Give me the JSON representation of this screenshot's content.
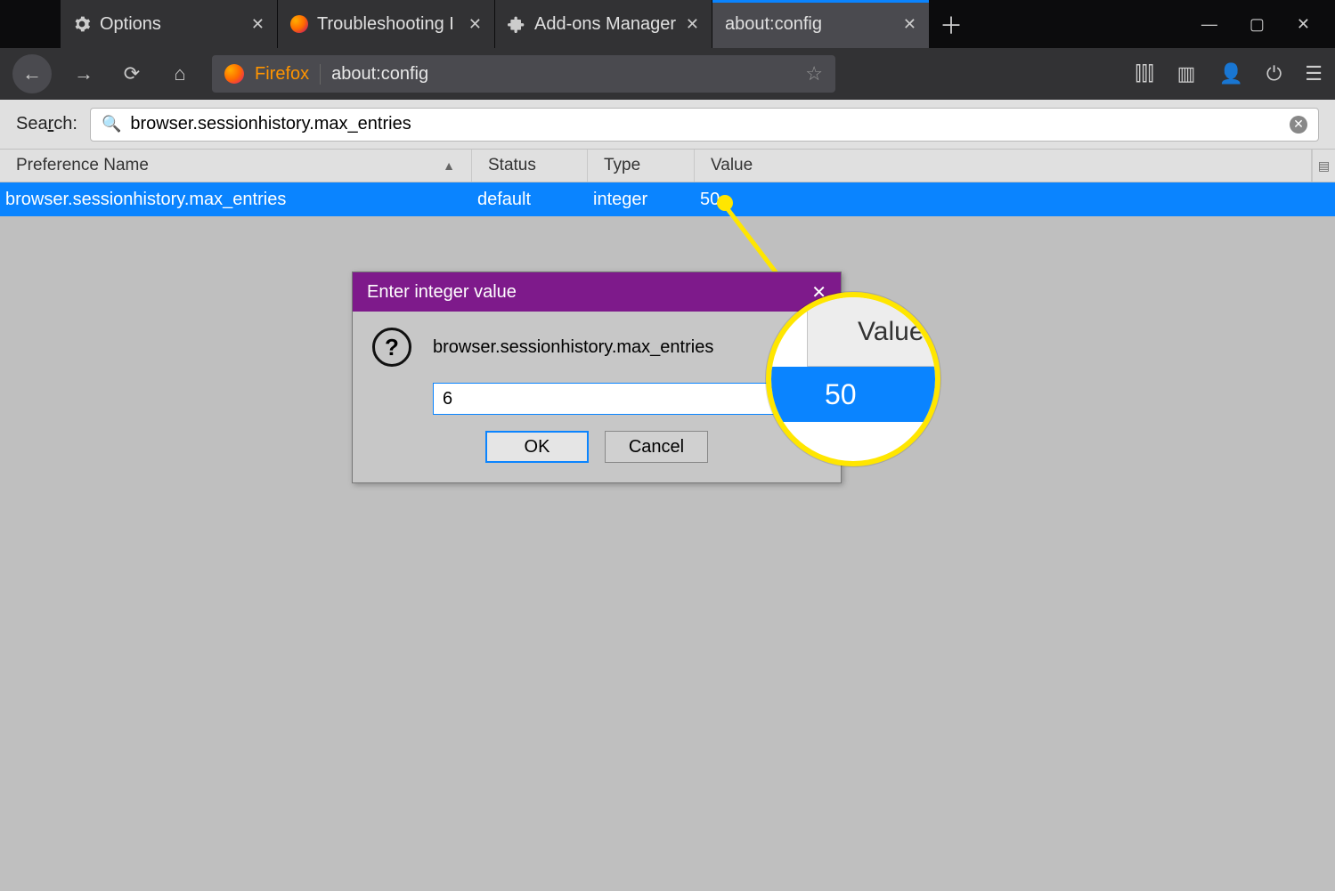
{
  "tabs": [
    {
      "label": "Options",
      "icon": "gear"
    },
    {
      "label": "Troubleshooting I",
      "icon": "firefox"
    },
    {
      "label": "Add-ons Manager",
      "icon": "puzzle"
    },
    {
      "label": "about:config",
      "icon": "",
      "active": true
    }
  ],
  "addressbar": {
    "brand": "Firefox",
    "url": "about:config"
  },
  "search": {
    "label": "Search:",
    "value": "browser.sessionhistory.max_entries"
  },
  "columns": {
    "name": "Preference Name",
    "status": "Status",
    "type": "Type",
    "value": "Value"
  },
  "row": {
    "name": "browser.sessionhistory.max_entries",
    "status": "default",
    "type": "integer",
    "value": "50"
  },
  "dialog": {
    "title": "Enter integer value",
    "pref": "browser.sessionhistory.max_entries",
    "input": "6",
    "ok": "OK",
    "cancel": "Cancel",
    "close": "✕"
  },
  "callout": {
    "header": "Value",
    "value": "50"
  }
}
